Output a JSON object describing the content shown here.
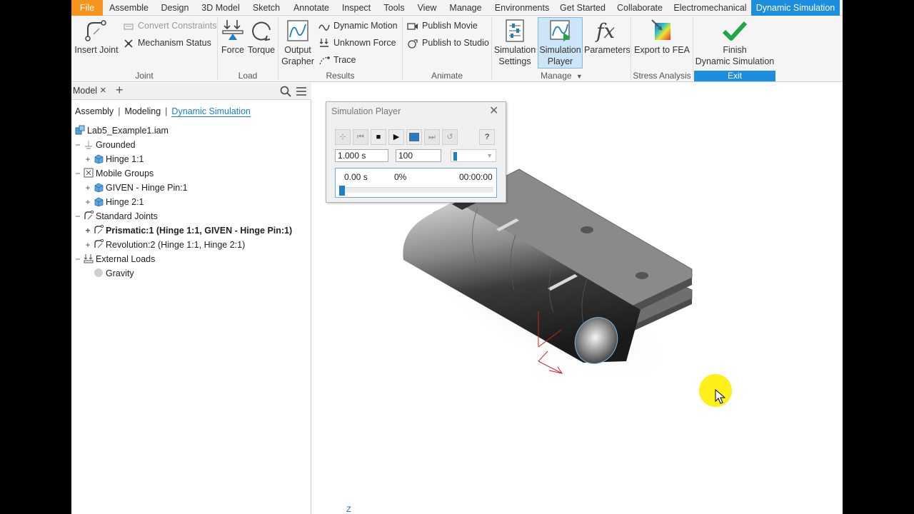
{
  "menu": {
    "tabs": [
      "File",
      "Assemble",
      "Design",
      "3D Model",
      "Sketch",
      "Annotate",
      "Inspect",
      "Tools",
      "View",
      "Manage",
      "Environments",
      "Get Started",
      "Collaborate",
      "Electromechanical",
      "Dynamic Simulation"
    ],
    "active": "Dynamic Simulation"
  },
  "ribbon": {
    "joint": {
      "insert_joint": "Insert Joint",
      "convert_constraints": "Convert Constraints",
      "mechanism_status": "Mechanism Status",
      "label": "Joint"
    },
    "load": {
      "force": "Force",
      "torque": "Torque",
      "label": "Load"
    },
    "results": {
      "output_grapher_1": "Output",
      "output_grapher_2": "Grapher",
      "dynamic_motion": "Dynamic Motion",
      "unknown_force": "Unknown Force",
      "trace": "Trace",
      "label": "Results"
    },
    "animate": {
      "publish_movie": "Publish Movie",
      "publish_studio": "Publish to Studio",
      "label": "Animate"
    },
    "manage": {
      "sim_settings_1": "Simulation",
      "sim_settings_2": "Settings",
      "sim_player_1": "Simulation",
      "sim_player_2": "Player",
      "parameters": "Parameters",
      "label": "Manage"
    },
    "stress": {
      "export_fea": "Export to FEA",
      "label": "Stress Analysis"
    },
    "exit": {
      "finish_1": "Finish",
      "finish_2": "Dynamic Simulation",
      "label": "Exit"
    }
  },
  "browser": {
    "tab": "Model",
    "modes": [
      "Assembly",
      "Modeling",
      "Dynamic Simulation"
    ],
    "active_mode": "Dynamic Simulation",
    "tree": [
      {
        "label": "Lab5_Example1.iam",
        "level": 0,
        "exp": "",
        "icon": "assembly-icon"
      },
      {
        "label": "Grounded",
        "level": 1,
        "exp": "−",
        "icon": "grounded-icon"
      },
      {
        "label": "Hinge 1:1",
        "level": 2,
        "exp": "+",
        "icon": "part-icon"
      },
      {
        "label": "Mobile Groups",
        "level": 1,
        "exp": "−",
        "icon": "mobile-groups-icon"
      },
      {
        "label": "GIVEN - Hinge Pin:1",
        "level": 2,
        "exp": "+",
        "icon": "part-icon"
      },
      {
        "label": "Hinge 2:1",
        "level": 2,
        "exp": "+",
        "icon": "part-icon"
      },
      {
        "label": "Standard Joints",
        "level": 1,
        "exp": "−",
        "icon": "joint-icon"
      },
      {
        "label": "Prismatic:1 (Hinge 1:1, GIVEN - Hinge Pin:1)",
        "level": 2,
        "exp": "+",
        "icon": "joint-icon",
        "bold": true
      },
      {
        "label": "Revolution:2 (Hinge 1:1, Hinge 2:1)",
        "level": 2,
        "exp": "+",
        "icon": "joint-icon"
      },
      {
        "label": "External Loads",
        "level": 1,
        "exp": "−",
        "icon": "loads-icon"
      },
      {
        "label": "Gravity",
        "level": 2,
        "exp": "",
        "icon": "gravity-icon"
      }
    ]
  },
  "sim_player": {
    "title": "Simulation Player",
    "end_time": "1.000 s",
    "images": "100",
    "time": "0.00 s",
    "percent": "0%",
    "clock": "00:00:00",
    "progress_fraction": 0.0
  },
  "viewport": {
    "axis_label": "Z"
  },
  "colors": {
    "accent": "#1c8ede",
    "file_tab": "#f7941d",
    "finish_check": "#1fa64a",
    "cursor_halo": "#ffee00"
  }
}
